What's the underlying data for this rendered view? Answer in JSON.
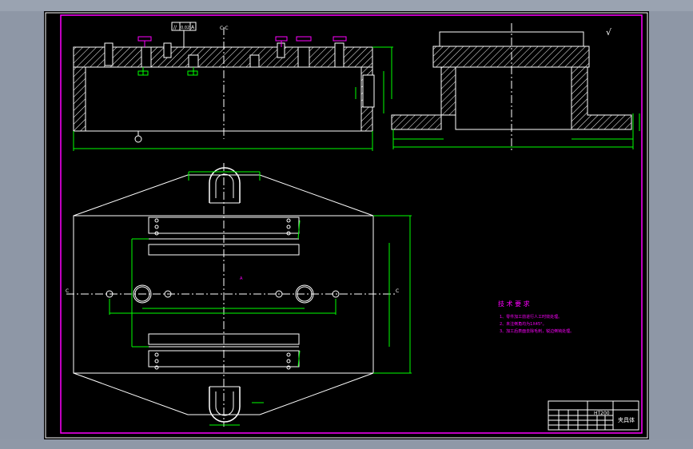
{
  "colors": {
    "sheet_background": "#000000",
    "outer_frame": "#ff00ff",
    "geometry": "#ffffff",
    "dimension": "#00ff00",
    "centerline": "#ffffff",
    "hatch": "#ffffff",
    "note_text": "#ff00ff",
    "tolerance_frame": "#ff00ff"
  },
  "views": {
    "section_label_left": "C-C",
    "view_label_front": "A",
    "section_marker_left": "C",
    "section_marker_right": "C",
    "surface_finish_symbol": "√"
  },
  "gdt": {
    "symbol": "//",
    "value": "0.02",
    "datum": "A"
  },
  "technical_requirements": {
    "title": "技 术 要 求",
    "items": [
      "1、零件加工前进行人工时效处理。",
      "2、未注倒角均为1X45°。",
      "3、加工后表面去除毛刺，锐边倒钝处理。"
    ]
  },
  "title_block": {
    "material": "HT200",
    "part_name": "夹具体"
  }
}
